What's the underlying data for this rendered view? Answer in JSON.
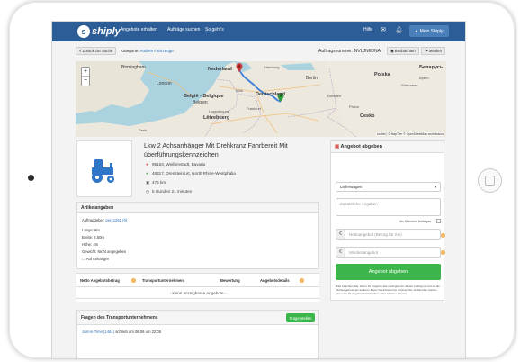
{
  "nav": {
    "logo": "shiply",
    "links": [
      "Angebote erhalten",
      "Aufträge suchen",
      "So geht's"
    ],
    "help": "Hilfe",
    "mail_icon": "mail-icon",
    "bell_icon": "bell-icon",
    "my_shiply": "Mein Shiply"
  },
  "breadcrumb": {
    "back": "« Zurück zur Suche",
    "category_label": "Kategorie:",
    "category_value": "Andere Fahrzeuge",
    "order_no": "Auftragsnummer: NVLJN6DNA",
    "watch": "Beobachten",
    "report": "Melden"
  },
  "map": {
    "labels": [
      "Birmingham",
      "London",
      "Nederland",
      "Berlin",
      "Polska",
      "Warszawa",
      "Беларусь",
      "Брест",
      "België - Belgique",
      "Belgien",
      "Deutschland",
      "Dresden",
      "Lëtzebuerg",
      "Česko",
      "Paris",
      "Praha",
      "Luxembourg",
      "Frankfurt",
      "Köln",
      "Hamburg"
    ],
    "attribution": "Leaflet | © MapTiler © OpenStreetMap contributors",
    "zoom_in": "+",
    "zoom_out": "−"
  },
  "listing": {
    "title": "Lkw 2 Achsanhänger Mit Drehkranz Fahrbereit Mit überführungskennzeichen",
    "from": "95163, Weißenstadt, Bavaria",
    "to": "48317, Drensteinfurt, North Rhine-Westphalia",
    "distance": "475 km",
    "duration": "5 stunden 21 minuten"
  },
  "article": {
    "heading": "Artikelangaben",
    "client_label": "Auftraggeber:",
    "client_value": "perc1261 (0)",
    "length": "Länge: 8m",
    "width": "Breite: 2.50m",
    "height": "Höhe: 4m",
    "weight": "Gewicht: Nicht angegeben",
    "trailer": "Auf Anhänger"
  },
  "offers_table": {
    "headers": [
      "Netto Angebotsbetrag",
      "Transportunternehmen",
      "Bewertung",
      "Angebotsdetails"
    ],
    "empty": "- keine anzeigbaren Angebote -"
  },
  "questions": {
    "heading": "Fragen des Transportunternehmens",
    "ask": "Frage stellen",
    "entry_user": "Just-in-Time (1461)",
    "entry_text": "schrieb am 06.06 um 22:05"
  },
  "bid": {
    "heading": "Angebot abgeben",
    "select_value": "Lieferwagen",
    "extra_placeholder": "Zusätzliche Angaben",
    "standard_label": "Als Standard festlegen",
    "net_placeholder": "Nettoangebot (Betrag für Sie)",
    "min_placeholder": "Mindestangebot",
    "currency": "€",
    "submit": "Angebot abgeben",
    "note": "Bitte beachten Sie: Wenn Ihr Angebot das niedrigste für diesen Auftrag ist und es die Mindestgebote der anderen Bieter beeinflusst hat, müssen Sie 12 Stunden warten, bevor Sie Ihr Angebot zurückziehen oder erhöhen können."
  },
  "colors": {
    "nav": "#2c5d96",
    "accent": "#3cb54a",
    "link": "#2c6fb5",
    "route": "#3f7fd6",
    "help": "#f0ad4e"
  }
}
